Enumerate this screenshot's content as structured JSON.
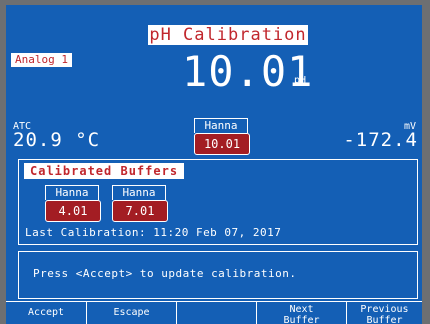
{
  "screen": {
    "title": "pH Calibration",
    "channel": "Analog 1",
    "ph_value": "10.01",
    "ph_unit": "pH",
    "atc_label": "ATC",
    "temperature": "20.9 °C",
    "mv_label": "mV",
    "mv_value": "-172.4",
    "current_buffer": {
      "name": "Hanna",
      "value": "10.01"
    }
  },
  "calibrated_buffers": {
    "title": "Calibrated Buffers",
    "buffers": [
      {
        "name": "Hanna",
        "value": "4.01"
      },
      {
        "name": "Hanna",
        "value": "7.01"
      }
    ],
    "last_calibration": "Last Calibration: 11:20 Feb 07, 2017"
  },
  "message": "Press <Accept> to update calibration.",
  "softkeys": [
    {
      "line1": "Accept",
      "line2": ""
    },
    {
      "line1": "Escape",
      "line2": ""
    },
    {
      "line1": "",
      "line2": ""
    },
    {
      "line1": "Next",
      "line2": "Buffer"
    },
    {
      "line1": "Previous",
      "line2": "Buffer"
    }
  ],
  "colors": {
    "lcd_background": "#145fb5",
    "highlight_text": "#c1272d",
    "buffer_tag": "#a31d23",
    "bezel": "#6d6f72"
  }
}
